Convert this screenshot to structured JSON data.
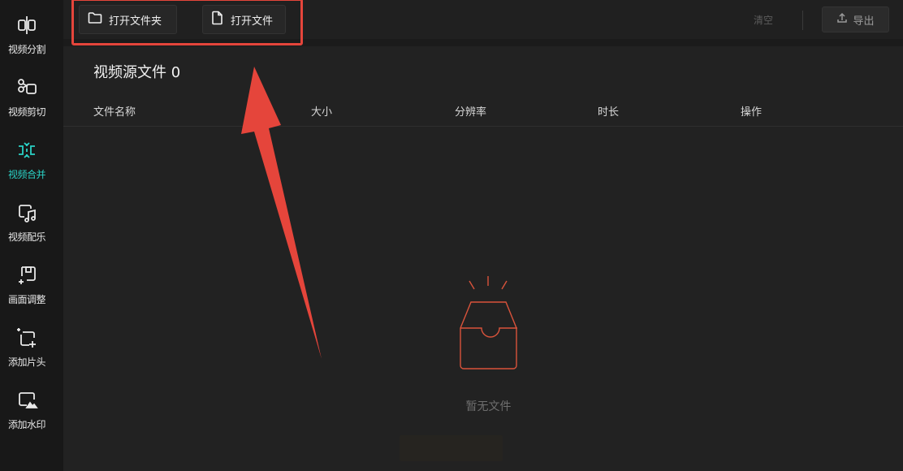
{
  "sidebar": {
    "items": [
      {
        "label": "视频分割",
        "icon": "video-split-icon"
      },
      {
        "label": "视频剪切",
        "icon": "video-cut-icon"
      },
      {
        "label": "视频合并",
        "icon": "video-merge-icon",
        "active": true
      },
      {
        "label": "视频配乐",
        "icon": "video-music-icon"
      },
      {
        "label": "画面调整",
        "icon": "picture-adjust-icon"
      },
      {
        "label": "添加片头",
        "icon": "add-intro-icon"
      },
      {
        "label": "添加水印",
        "icon": "add-watermark-icon"
      }
    ]
  },
  "toolbar": {
    "open_folder": "打开文件夹",
    "open_file": "打开文件",
    "clear": "清空",
    "export": "导出"
  },
  "main": {
    "title": "视频源文件 0",
    "columns": [
      "文件名称",
      "大小",
      "分辨率",
      "时长",
      "操作"
    ],
    "empty_text": "暂无文件"
  },
  "colors": {
    "accent": "#2ad1c5",
    "annotation": "#e5453b",
    "empty_icon": "#d9533b"
  }
}
